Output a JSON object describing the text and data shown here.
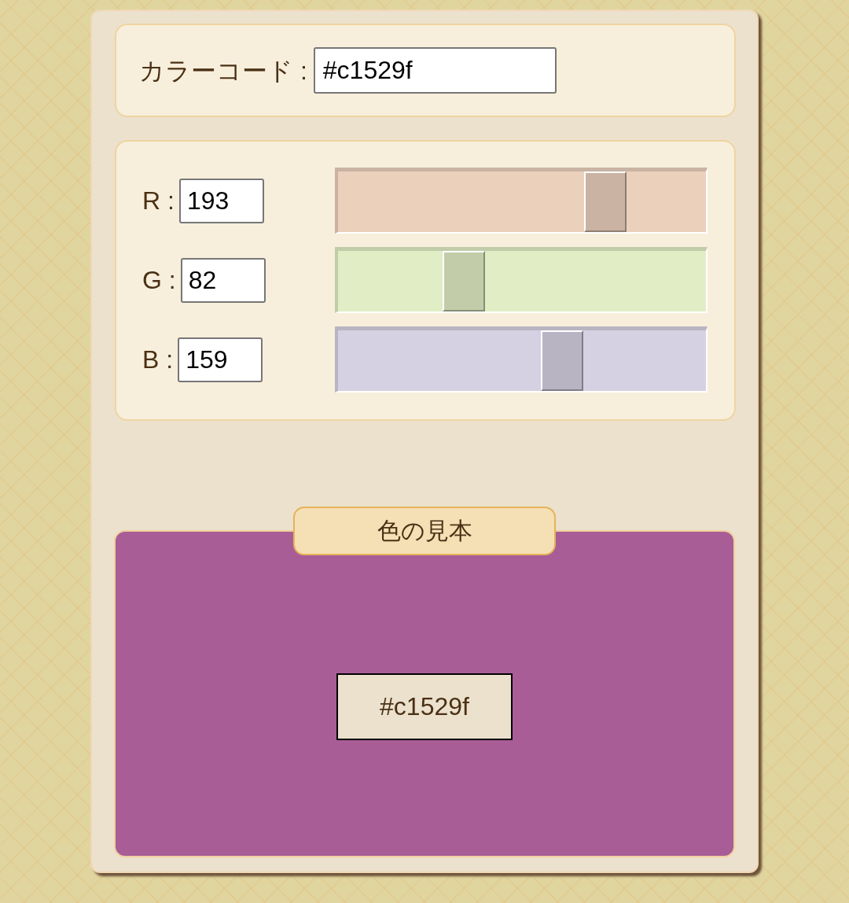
{
  "color_code": {
    "label": "カラーコード :",
    "value": "#c1529f"
  },
  "channels": [
    {
      "label": "R :",
      "value": "193",
      "level": 0.757,
      "color": "#ebd0bc"
    },
    {
      "label": "G :",
      "value": "82",
      "level": 0.322,
      "color": "#e1edc4"
    },
    {
      "label": "B :",
      "value": "159",
      "level": 0.624,
      "color": "#d6d1e2"
    }
  ],
  "swatch": {
    "title": "色の見本",
    "color": "#a85d97",
    "code": "#c1529f"
  }
}
